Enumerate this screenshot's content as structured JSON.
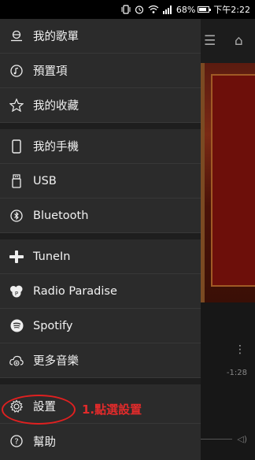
{
  "status_bar": {
    "battery": "68%",
    "time": "下午2:22",
    "icons": [
      "vibrate-icon",
      "alarm-icon",
      "wifi-icon",
      "signal-icon",
      "battery-icon"
    ]
  },
  "menu": {
    "items": [
      {
        "label": "我的歌單",
        "icon": "playlist-icon"
      },
      {
        "label": "預置項",
        "icon": "preset-icon"
      },
      {
        "label": "我的收藏",
        "icon": "star-icon"
      },
      {
        "label": "我的手機",
        "icon": "phone-icon"
      },
      {
        "label": "USB",
        "icon": "usb-icon"
      },
      {
        "label": "Bluetooth",
        "icon": "bluetooth-icon"
      },
      {
        "label": "TuneIn",
        "icon": "tunein-icon"
      },
      {
        "label": "Radio Paradise",
        "icon": "radio-paradise-icon"
      },
      {
        "label": "Spotify",
        "icon": "spotify-icon"
      },
      {
        "label": "更多音樂",
        "icon": "more-music-icon"
      },
      {
        "label": "設置",
        "icon": "settings-icon"
      },
      {
        "label": "幫助",
        "icon": "help-icon"
      }
    ]
  },
  "annotation": {
    "text": "1.點選設置",
    "color": "#e02020"
  },
  "background": {
    "time": "-1:28"
  }
}
